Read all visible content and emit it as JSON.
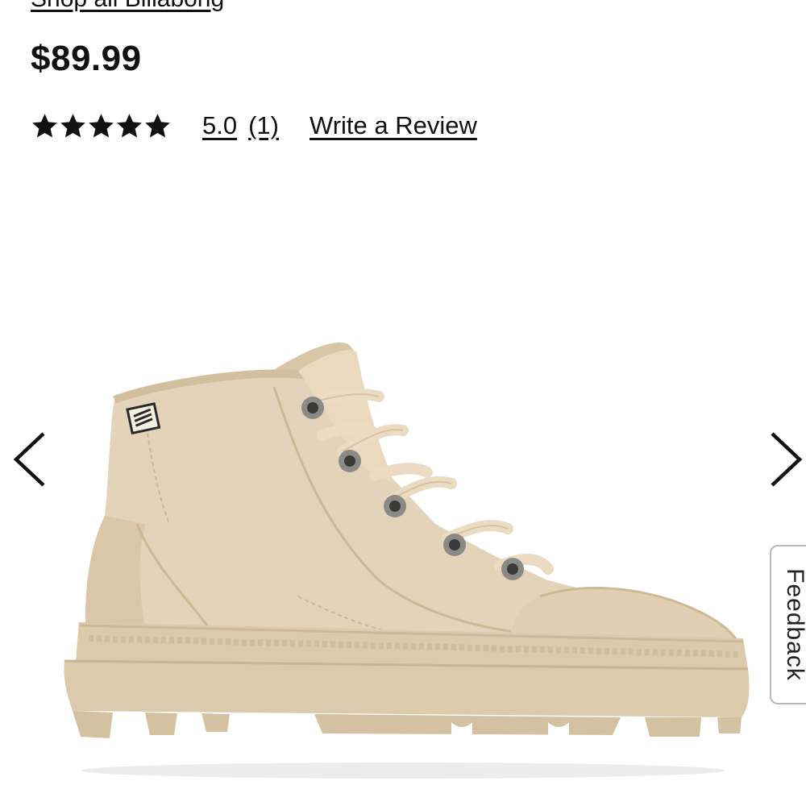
{
  "product": {
    "brand_link": "Shop all Billabong",
    "price": "$89.99",
    "rating": {
      "stars": 5,
      "value": "5.0",
      "count": "(1)",
      "write_review": "Write a Review"
    }
  },
  "gallery": {
    "prev_icon": "chevron-left-icon",
    "next_icon": "chevron-right-icon",
    "image_alt": "Beige canvas lace-up high-top boot"
  },
  "feedback": {
    "label": "Feedback"
  },
  "colors": {
    "text": "#111111",
    "boot": "#e3d3b8",
    "boot_shadow": "#d1bf9f",
    "sole": "#dccaac"
  }
}
